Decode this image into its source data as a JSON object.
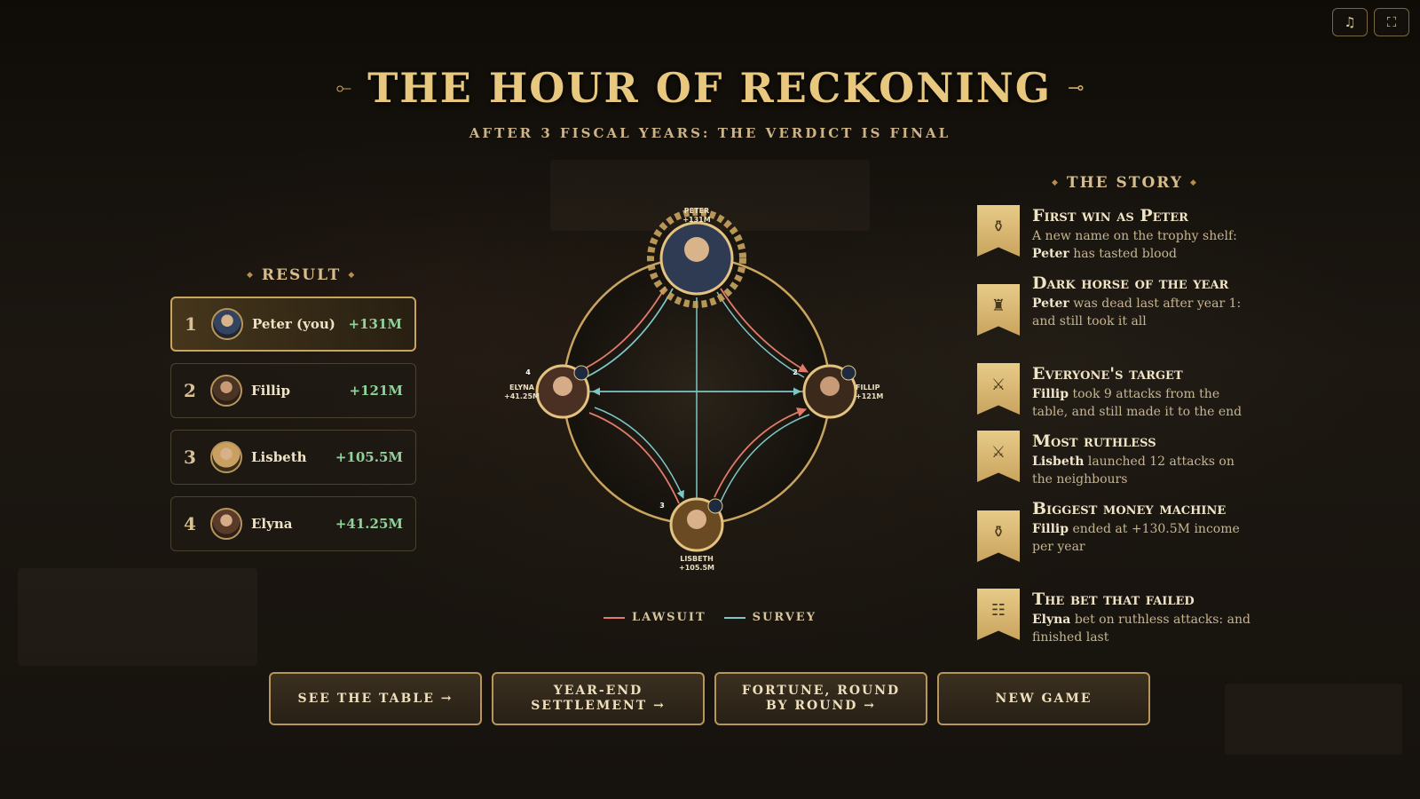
{
  "header": {
    "title": "THE HOUR OF RECKONING",
    "subtitle": "AFTER 3 FISCAL YEARS: THE VERDICT IS FINAL",
    "title_ornament": "⟜"
  },
  "top_buttons": {
    "music_icon": "♫",
    "fullscreen_icon": "⛶"
  },
  "result": {
    "title": "RESULT",
    "rows": [
      {
        "rank": "1",
        "name": "Peter (you)",
        "score": "+131M"
      },
      {
        "rank": "2",
        "name": "Fillip",
        "score": "+121M"
      },
      {
        "rank": "3",
        "name": "Lisbeth",
        "score": "+105.5M"
      },
      {
        "rank": "4",
        "name": "Elyna",
        "score": "+41.25M"
      }
    ]
  },
  "graph": {
    "nodes": [
      {
        "id": "peter",
        "name": "PETER",
        "score": "+131M",
        "badge": ""
      },
      {
        "id": "fillip",
        "name": "FILLIP",
        "score": "+121M",
        "badge": "2"
      },
      {
        "id": "lisbeth",
        "name": "LISBETH",
        "score": "+105.5M",
        "badge": "3"
      },
      {
        "id": "elyna",
        "name": "ELYNA",
        "score": "+41.25M",
        "badge": "4"
      }
    ],
    "legend": [
      {
        "label": "LAWSUIT",
        "color": "#e07a6a"
      },
      {
        "label": "SURVEY",
        "color": "#7cc6c4"
      }
    ]
  },
  "story": {
    "title": "THE STORY",
    "items": [
      {
        "icon": "money-bag-icon",
        "glyph": "⚱",
        "title": "First win as Peter",
        "pre": "A new name on the trophy shelf: ",
        "bold": "Peter",
        "post": " has tasted blood"
      },
      {
        "icon": "throne-icon",
        "glyph": "♜",
        "title": "Dark horse of the year",
        "pre": "",
        "bold": "Peter",
        "post": " was dead last after year 1: and still took it all"
      },
      {
        "icon": "crossed-swords-icon",
        "glyph": "⚔",
        "title": "Everyone's target",
        "pre": "",
        "bold": "Fillip",
        "post": " took 9 attacks from the table, and still made it to the end"
      },
      {
        "icon": "crossed-swords-icon",
        "glyph": "⚔",
        "title": "Most ruthless",
        "pre": "",
        "bold": "Lisbeth",
        "post": " launched 12 attacks on the neighbours"
      },
      {
        "icon": "money-bag-icon",
        "glyph": "⚱",
        "title": "Biggest money machine",
        "pre": "",
        "bold": "Fillip",
        "post": " ended at +130.5M income per year"
      },
      {
        "icon": "ledger-icon",
        "glyph": "☷",
        "title": "The bet that failed",
        "pre": "",
        "bold": "Elyna",
        "post": " bet on ruthless attacks: and finished last"
      }
    ]
  },
  "buttons": {
    "see_table": "SEE THE TABLE →",
    "settlement": "YEAR-END SETTLEMENT →",
    "fortune": "FORTUNE, ROUND BY ROUND →",
    "new_game": "NEW GAME"
  },
  "colors": {
    "gold": "#e8c77f",
    "lawsuit": "#e07a6a",
    "survey": "#7cc6c4",
    "score_green": "#8fd39a"
  }
}
